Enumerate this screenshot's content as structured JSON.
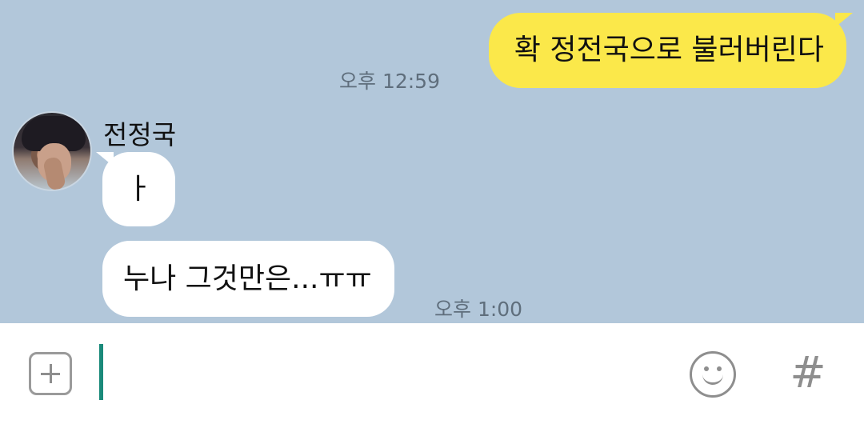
{
  "messages": {
    "outgoing": {
      "text": "확 정전국으로 불러버린다",
      "time": "오후 12:59"
    },
    "incoming": {
      "sender": "전정국",
      "avatar_icon": "profile-photo",
      "bubbles": [
        {
          "text": "ㅏ"
        },
        {
          "text": "누나 그것만은...ㅠㅠ"
        }
      ],
      "time": "오후 1:00"
    }
  },
  "input_bar": {
    "placeholder": "",
    "value": "",
    "plus_icon": "plus-square-icon",
    "emoji_icon": "smiley-icon",
    "hash_label": "#"
  },
  "colors": {
    "chat_background": "#b2c7da",
    "outgoing_bubble": "#fbe84a",
    "incoming_bubble": "#ffffff",
    "cursor": "#1a8a7a"
  }
}
